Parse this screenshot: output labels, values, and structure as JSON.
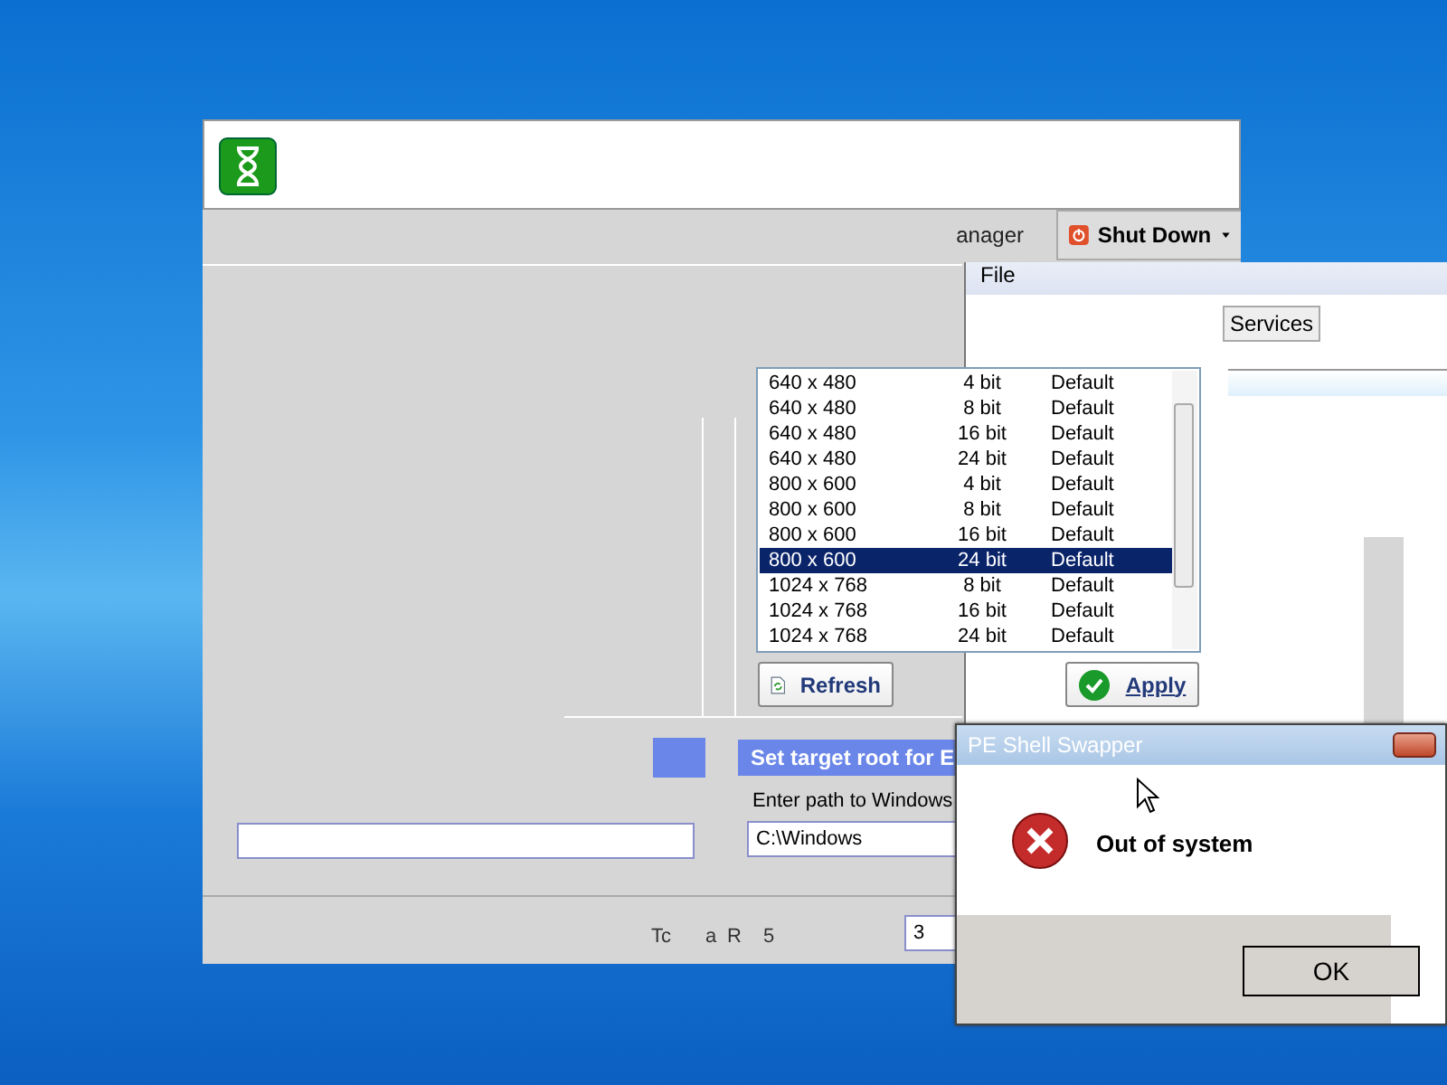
{
  "main_window": {
    "toolbar": {
      "partial_label": "anager",
      "shutdown_button": "Shut Down"
    }
  },
  "background_window": {
    "menu": [
      "File"
    ],
    "tabs": [
      {
        "label": "Services",
        "selected": false
      }
    ]
  },
  "resolution_list": {
    "rows": [
      {
        "resolution": "640 x 480",
        "depth": "4 bit",
        "refresh": "Default",
        "selected": false
      },
      {
        "resolution": "640 x 480",
        "depth": "8 bit",
        "refresh": "Default",
        "selected": false
      },
      {
        "resolution": "640 x 480",
        "depth": "16 bit",
        "refresh": "Default",
        "selected": false
      },
      {
        "resolution": "640 x 480",
        "depth": "24 bit",
        "refresh": "Default",
        "selected": false
      },
      {
        "resolution": "800 x 600",
        "depth": "4 bit",
        "refresh": "Default",
        "selected": false
      },
      {
        "resolution": "800 x 600",
        "depth": "8 bit",
        "refresh": "Default",
        "selected": false
      },
      {
        "resolution": "800 x 600",
        "depth": "16 bit",
        "refresh": "Default",
        "selected": false
      },
      {
        "resolution": "800 x 600",
        "depth": "24 bit",
        "refresh": "Default",
        "selected": true
      },
      {
        "resolution": "1024 x 768",
        "depth": "8 bit",
        "refresh": "Default",
        "selected": false
      },
      {
        "resolution": "1024 x 768",
        "depth": "16 bit",
        "refresh": "Default",
        "selected": false
      },
      {
        "resolution": "1024 x 768",
        "depth": "24 bit",
        "refresh": "Default",
        "selected": false
      }
    ]
  },
  "buttons": {
    "refresh": "Refresh",
    "apply": "Apply"
  },
  "target_root": {
    "title": "Set target root for E",
    "label": "Enter path to Windows",
    "value": "C:\\Windows"
  },
  "status_bar": {
    "fragments": [
      "Tc",
      "a",
      "R",
      "5"
    ],
    "field_value": "3"
  },
  "dialog": {
    "title": "PE Shell Swapper",
    "message": "Out of system",
    "button": "OK"
  }
}
